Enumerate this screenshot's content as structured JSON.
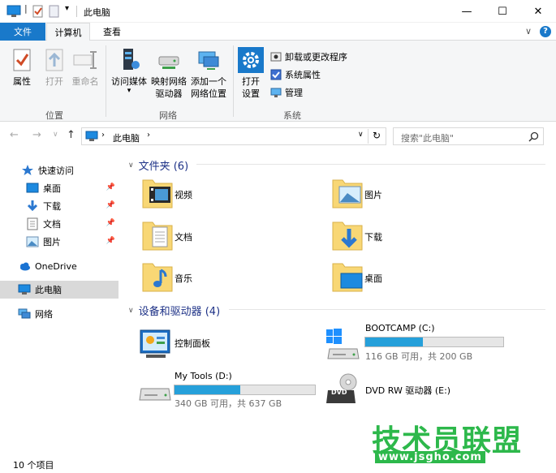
{
  "window": {
    "title": "此电脑",
    "minimize": "—",
    "maximize": "☐",
    "close": "✕"
  },
  "tabs": {
    "file": "文件",
    "computer": "计算机",
    "view": "查看"
  },
  "ribbon": {
    "location": {
      "label": "位置",
      "properties": "属性",
      "open": "打开",
      "rename": "重命名"
    },
    "network": {
      "label": "网络",
      "access_media": "访问媒体",
      "map_drive_line1": "映射网络",
      "map_drive_line2": "驱动器",
      "add_location_line1": "添加一个",
      "add_location_line2": "网络位置"
    },
    "system": {
      "label": "系统",
      "open_settings_line1": "打开",
      "open_settings_line2": "设置",
      "uninstall": "卸载或更改程序",
      "system_properties": "系统属性",
      "manage": "管理"
    }
  },
  "address": {
    "path": "此电脑",
    "search_placeholder": "搜索\"此电脑\""
  },
  "nav": {
    "quick_access": "快速访问",
    "desktop": "桌面",
    "downloads": "下载",
    "documents": "文档",
    "pictures": "图片",
    "onedrive": "OneDrive",
    "this_pc": "此电脑",
    "network": "网络"
  },
  "content": {
    "folders_header": "文件夹 (6)",
    "folders": [
      "视频",
      "图片",
      "文档",
      "下载",
      "音乐",
      "桌面"
    ],
    "devices_header": "设备和驱动器 (4)",
    "control_panel": "控制面板",
    "drives": [
      {
        "name": "BOOTCAMP (C:)",
        "free": "116 GB 可用，共 200 GB",
        "used_fraction": 0.42
      },
      {
        "name": "My Tools (D:)",
        "free": "340 GB 可用，共 637 GB",
        "used_fraction": 0.47
      }
    ],
    "dvd": "DVD RW 驱动器 (E:)",
    "dvd_badge": "DVD"
  },
  "status": {
    "count": "10 个项目"
  },
  "watermark": {
    "text": "技术员联盟",
    "url": "www.jsgho.com"
  },
  "colors": {
    "accent": "#1979ca",
    "bar_fill": "#26a0da",
    "folder": "#f8d775",
    "section_header": "#1e3287"
  }
}
